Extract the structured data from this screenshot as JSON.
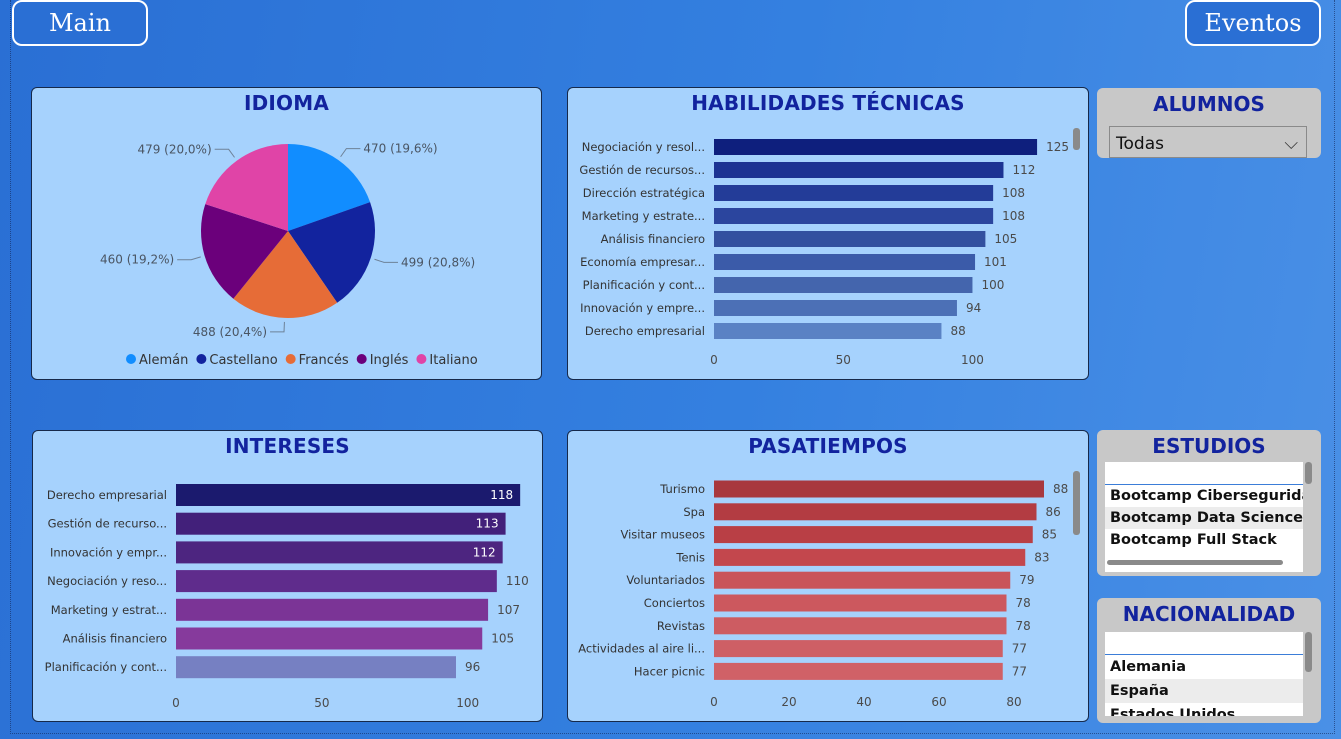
{
  "nav": {
    "main_label": "Main",
    "eventos_label": "Eventos"
  },
  "colors": {
    "title": "#12239e",
    "habilidades": [
      "#0e1f7d",
      "#1c3393",
      "#233c98",
      "#2b459e",
      "#33509f",
      "#3b5ba9",
      "#4465ad",
      "#4c70b6",
      "#5a82c4"
    ],
    "intereses": [
      "#1b1a6e",
      "#42207a",
      "#4d2580",
      "#5f2c8c",
      "#7b3496",
      "#863a9c",
      "#7680c2"
    ],
    "pasatiempos": [
      "#a8383e",
      "#b33c42",
      "#b93f45",
      "#c3474d",
      "#c9545a",
      "#cc585e",
      "#cd5c62",
      "#ce5f65",
      "#d06167"
    ]
  },
  "chart_data": [
    {
      "id": "idioma",
      "type": "pie",
      "title": "IDIOMA",
      "categories": [
        "Alemán",
        "Castellano",
        "Francés",
        "Inglés",
        "Italiano"
      ],
      "values": [
        470,
        499,
        488,
        460,
        479
      ],
      "labels": [
        "470 (19,6%)",
        "499 (20,8%)",
        "488 (20,4%)",
        "460 (19,2%)",
        "479 (20,0%)"
      ],
      "colors": [
        "#118dff",
        "#12239e",
        "#e66c37",
        "#6b007b",
        "#e044a7"
      ],
      "legend": "bottom"
    },
    {
      "id": "habilidades",
      "type": "bar",
      "orientation": "horizontal",
      "title": "HABILIDADES TÉCNICAS",
      "categories": [
        "Negociación y resol...",
        "Gestión de recursos...",
        "Dirección estratégica",
        "Marketing y estrate...",
        "Análisis financiero",
        "Economía empresar...",
        "Planificación y cont...",
        "Innovación y empre...",
        "Derecho empresarial"
      ],
      "values": [
        125,
        112,
        108,
        108,
        105,
        101,
        100,
        94,
        88
      ],
      "xticks": [
        0,
        50,
        100
      ],
      "xlim": [
        0,
        130
      ],
      "grid": false,
      "labels_inside_from": null
    },
    {
      "id": "intereses",
      "type": "bar",
      "orientation": "horizontal",
      "title": "INTERESES",
      "categories": [
        "Derecho empresarial",
        "Gestión de recurso...",
        "Innovación y empr...",
        "Negociación y reso...",
        "Marketing y estrat...",
        "Análisis financiero",
        "Planificación y cont..."
      ],
      "values": [
        118,
        113,
        112,
        110,
        107,
        105,
        96
      ],
      "xticks": [
        0,
        50,
        100
      ],
      "xlim": [
        0,
        120
      ],
      "grid": false,
      "labels_inside_from": 112
    },
    {
      "id": "pasatiempos",
      "type": "bar",
      "orientation": "horizontal",
      "title": "PASATIEMPOS",
      "categories": [
        "Turismo",
        "Spa",
        "Visitar museos",
        "Tenis",
        "Voluntariados",
        "Conciertos",
        "Revistas",
        "Actividades al aire li...",
        "Hacer picnic"
      ],
      "values": [
        88,
        86,
        85,
        83,
        79,
        78,
        78,
        77,
        77
      ],
      "xticks": [
        0,
        20,
        40,
        60,
        80
      ],
      "xlim": [
        0,
        88
      ],
      "grid": false,
      "labels_inside_from": null
    }
  ],
  "slicers": {
    "alumnos": {
      "title": "ALUMNOS",
      "selected": "Todas"
    },
    "estudios": {
      "title": "ESTUDIOS",
      "items": [
        "Bootcamp Ciberseguridad",
        "Bootcamp Data Science",
        "Bootcamp Full Stack"
      ]
    },
    "nacionalidad": {
      "title": "NACIONALIDAD",
      "items": [
        "Alemania",
        "España",
        "Estados Unidos"
      ]
    }
  }
}
